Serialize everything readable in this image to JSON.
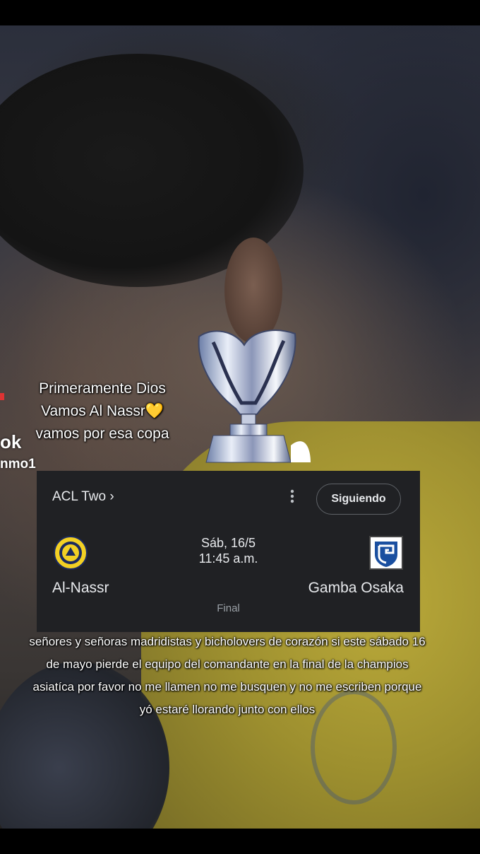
{
  "overlay": {
    "caption_top_lines": [
      "Primeramente Dios",
      "Vamos Al Nassr",
      "vamos por esa copa"
    ],
    "heart_emoji": "💛",
    "edge_text_1": "ok",
    "edge_text_2": "nmo1",
    "caption_bottom": "señores y señoras madridistas y bicholovers de corazón si este sábado 16 de mayo pierde el equipo del comandante en la final de la champios asiatíca por favor no me llamen no me busquen y no me escriben porque yó estaré llorando junto con ellos"
  },
  "match_card": {
    "league": "ACL Two",
    "league_chevron": "›",
    "menu_icon": "more-vert-icon",
    "follow_label": "Siguiendo",
    "date": "Sáb, 16/5",
    "time": "11:45 a.m.",
    "home_team": "Al-Nassr",
    "away_team": "Gamba Osaka",
    "status": "Final"
  },
  "colors": {
    "card_bg": "#202124",
    "card_text": "#e8eaed",
    "status_text": "#9aa0a6",
    "al_nassr_gold": "#f2d024",
    "gamba_blue": "#1a4fa0"
  }
}
